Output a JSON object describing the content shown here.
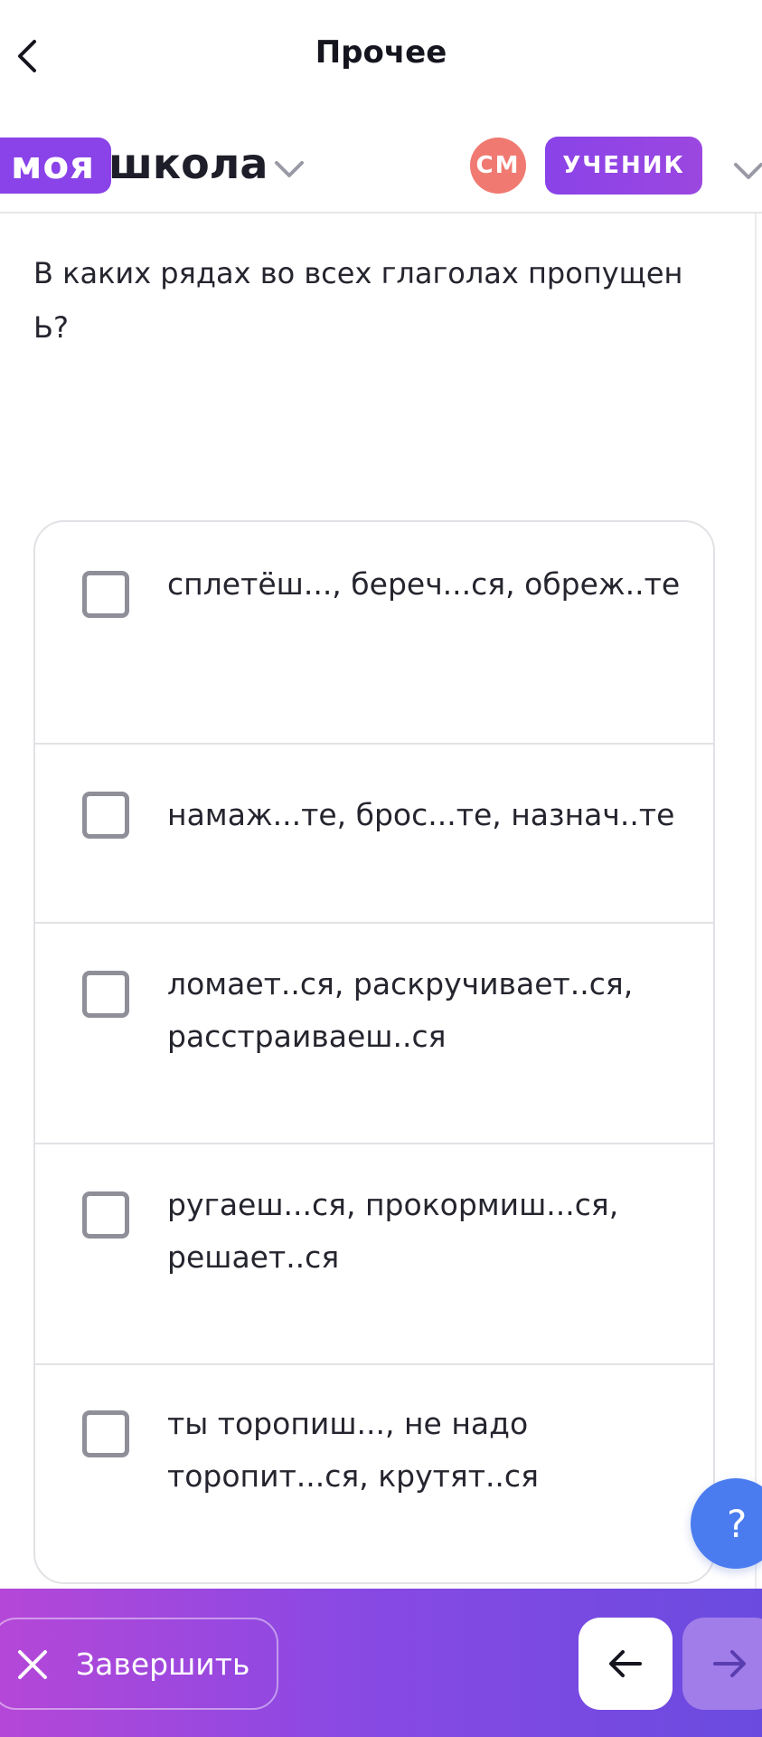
{
  "header": {
    "title": "Прочее"
  },
  "brand": {
    "logo_part1": "моя",
    "logo_part2": "школа"
  },
  "user": {
    "initials": "СМ",
    "role": "УЧЕНИК"
  },
  "question": {
    "text": "В каких рядах во всех глаголах пропущен Ь?"
  },
  "options": [
    {
      "text": "сплетёш..., береч...ся, обреж..те",
      "checked": false
    },
    {
      "text": "намаж...те, брос...те, назнач..те",
      "checked": false
    },
    {
      "text": "ломает..ся, раскручивает..ся, расстраиваеш..ся",
      "checked": false
    },
    {
      "text": "ругаеш...ся, прокормиш...ся, решает..ся",
      "checked": false
    },
    {
      "text": "ты торопиш..., не надо торопит...ся, крутят..ся",
      "checked": false
    }
  ],
  "help": {
    "label": "?"
  },
  "footer": {
    "finish_label": "Завершить"
  },
  "colors": {
    "accent": "#8a43e8",
    "avatar": "#f07a72",
    "help": "#4a7cf0",
    "footer_start": "#b447d8",
    "footer_end": "#6a4be0"
  },
  "icons": {
    "back": "chevron-left-icon",
    "brand_menu": "chevron-down-icon",
    "role_menu": "chevron-down-icon",
    "finish": "close-icon",
    "prev": "arrow-left-icon",
    "next": "arrow-right-icon"
  }
}
